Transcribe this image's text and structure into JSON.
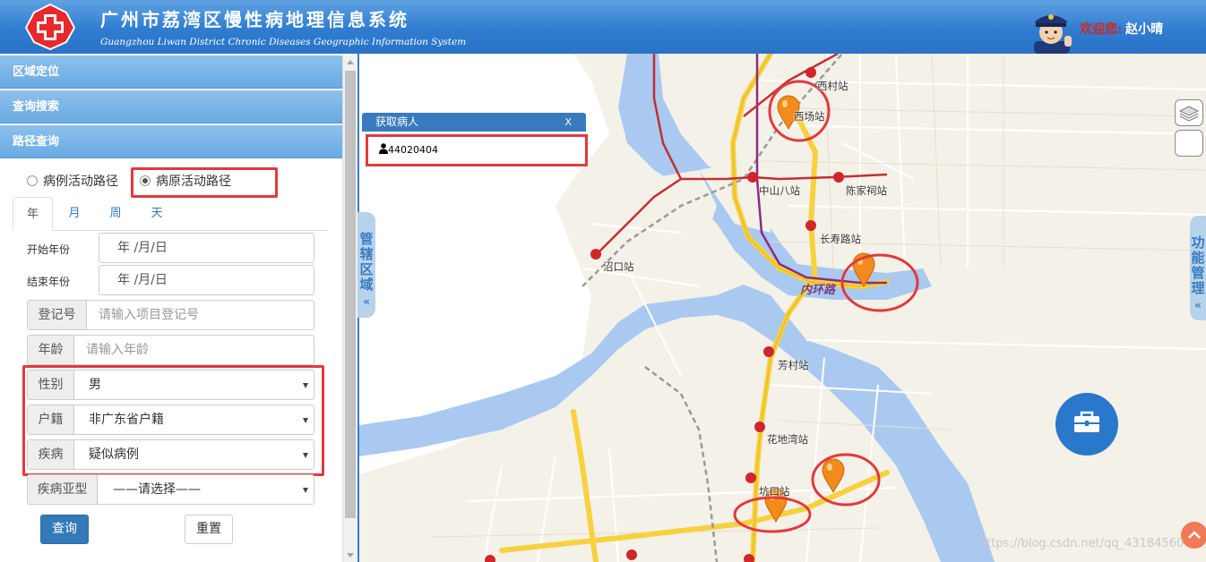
{
  "header": {
    "title_cn": "广州市荔湾区慢性病地理信息系统",
    "title_en": "Guangzhou Liwan District Chronic Diseases Geographic Information System",
    "welcome_label": "欢迎您:",
    "username": "赵小晴",
    "logo_icon": "red-cross-icon",
    "avatar_icon": "police-avatar-icon"
  },
  "sidebar": {
    "sections": [
      "区域定位",
      "查询搜索",
      "路径查询"
    ],
    "path_types": [
      "病例活动路径",
      "病原活动路径"
    ],
    "selected_path_type": "病原活动路径",
    "tabs": [
      "年",
      "月",
      "周",
      "天"
    ],
    "active_tab": "年",
    "start_year_label": "开始年份",
    "end_year_label": "结束年份",
    "date_placeholder": "年  /月/日",
    "registration": {
      "label": "登记号",
      "placeholder": "请输入项目登记号"
    },
    "age": {
      "label": "年龄",
      "placeholder": "请输入年龄"
    },
    "gender": {
      "label": "性别",
      "value": "男"
    },
    "household": {
      "label": "户籍",
      "value": "非广东省户籍"
    },
    "disease": {
      "label": "疾病",
      "value": "疑似病例"
    },
    "disease_subtype": {
      "label": "疾病亚型",
      "value": "——请选择——"
    },
    "query_button": "查询",
    "reset_button": "重置"
  },
  "map": {
    "popup_title": "获取病人",
    "popup_close": "X",
    "patient_id": "44020404",
    "left_tab": "管辖区域",
    "right_tab": "功能管理",
    "collapse_glyph": "«",
    "stations": [
      "西村站",
      "西场站",
      "中山八站",
      "陈家祠站",
      "长寿路站",
      "沼口站",
      "芳村站",
      "花地湾站",
      "坑口站"
    ],
    "road_label": "内环路",
    "markers": 4,
    "accent_color": "#2a78cc",
    "highlight_color": "#e2393d",
    "marker_color": "#f28a1c",
    "icons": [
      "layers-icon",
      "toolbox-icon",
      "back-to-top-icon",
      "person-icon",
      "metro-icon"
    ]
  },
  "watermark": "https://blog.csdn.net/qq_43184560"
}
